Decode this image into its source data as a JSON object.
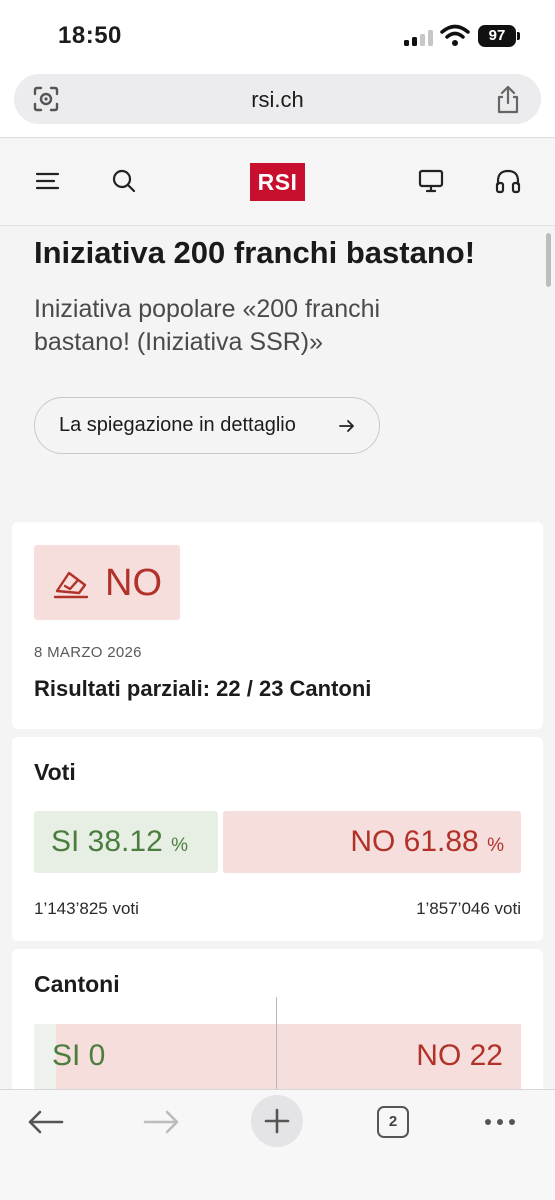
{
  "status_bar": {
    "time": "18:50",
    "battery": "97"
  },
  "browser": {
    "url": "rsi.ch",
    "tab_count": "2"
  },
  "site": {
    "logo_text": "RSI",
    "icons": [
      "menu-icon",
      "search-icon",
      "tv-icon",
      "headphones-icon"
    ]
  },
  "article": {
    "title": "Iniziativa 200 franchi bastano!",
    "subtitle": "Iniziativa popolare «200 franchi bastano! (Iniziativa SSR)»",
    "detail_button": "La spiegazione in dettaglio"
  },
  "result": {
    "outcome": "NO",
    "date": "8 MARZO 2026",
    "partial": "Risultati parziali: 22 / 23 Cantoni"
  },
  "votes": {
    "title": "Voti",
    "si_label": "SI 38.12",
    "no_label": "NO 61.88",
    "pct_symbol": "%",
    "si_votes": "1’143’825 voti",
    "no_votes": "1’857’046 voti",
    "si_share": 38.12,
    "no_share": 61.88
  },
  "cantons": {
    "title": "Cantoni",
    "si_label": "SI 0",
    "no_label": "NO 22",
    "si_count": 0,
    "no_count": 22
  },
  "colors": {
    "rsi_red": "#c8102e",
    "no_red": "#b2322a",
    "no_bg": "#f6dedc",
    "si_green": "#4b7e3e",
    "si_bg": "#e7efe5"
  }
}
